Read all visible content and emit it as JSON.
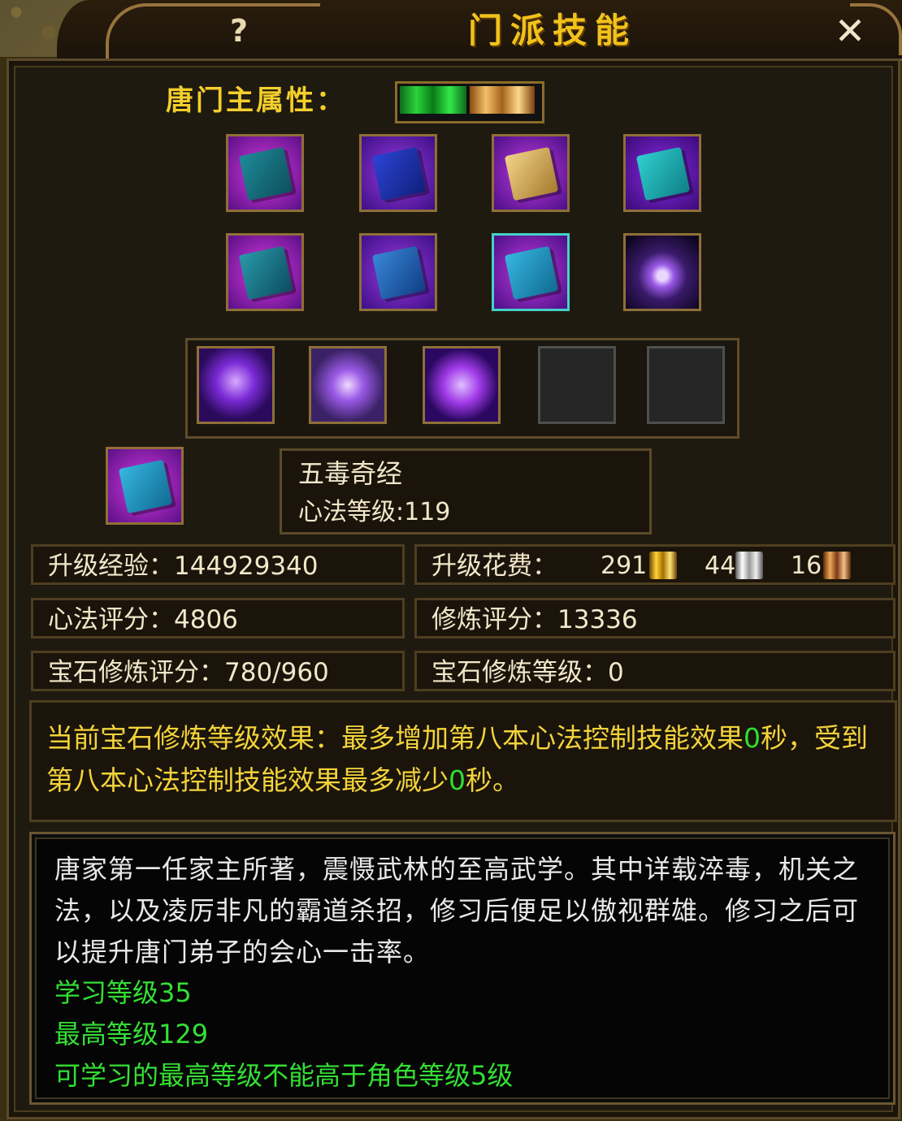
{
  "window": {
    "title": "门派技能",
    "help_label": "?",
    "close_label": "✕"
  },
  "attribute": {
    "label": "唐门主属性："
  },
  "skills": {
    "row1": [
      "book-teal-icon",
      "book-blue-icon",
      "scroll-gold-icon",
      "book-cyan-icon"
    ],
    "row2": [
      "book-stack-icon",
      "book-blue-stack-icon",
      "book-cyan-selected-icon",
      "galaxy-icon"
    ],
    "row3": [
      "ghost-robe-icon",
      "crystal-burst-icon",
      "skull-flame-icon",
      "empty-slot",
      "empty-slot"
    ]
  },
  "selected": {
    "name": "五毒奇经",
    "level": "心法等级:119"
  },
  "stats": {
    "exp": "升级经验：144929340",
    "cost_label": "升级花费：",
    "cost_gold": "291",
    "cost_silver": "44",
    "cost_copper": "16",
    "xinfa_score": "心法评分：4806",
    "train_score": "修炼评分：13336",
    "gem_score": "宝石修炼评分：780/960",
    "gem_level": "宝石修炼等级：0"
  },
  "effect": {
    "part1": "当前宝石修炼等级效果：最多增加第八本心法控制技能效果",
    "value1": "0",
    "part2": "秒，受到第八本心法控制技能效果最多减少",
    "value2": "0",
    "part3": "秒。"
  },
  "description": {
    "text": "唐家第一任家主所著，震慑武林的至高武学。其中详载淬毒，机关之法，以及凌厉非凡的霸道杀招，修习后便足以傲视群雄。修习之后可以提升唐门弟子的会心一击率。",
    "learn_level": "学习等级35",
    "max_level": "最高等级129",
    "note": "可学习的最高等级不能高于角色等级5级"
  }
}
